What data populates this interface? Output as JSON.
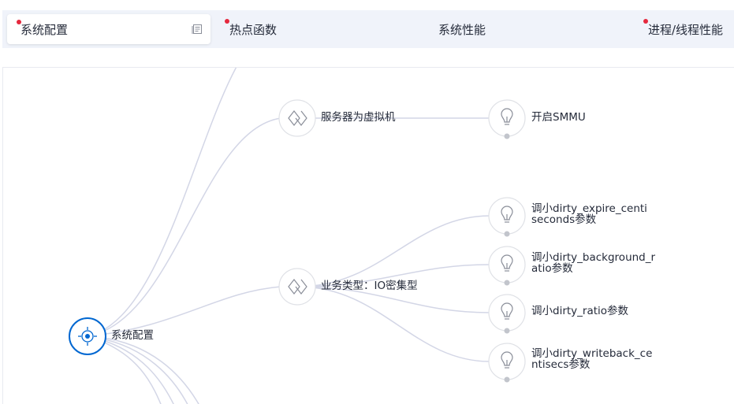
{
  "tabs": [
    {
      "label": "系统配置",
      "active": true,
      "dot": true
    },
    {
      "label": "热点函数",
      "active": false,
      "dot": true
    },
    {
      "label": "系统性能",
      "active": false,
      "dot": false
    },
    {
      "label": "进程/线程性能",
      "active": false,
      "dot": true
    }
  ],
  "graph": {
    "root": {
      "label": "系统配置",
      "icon": "target-icon"
    },
    "categories": [
      {
        "label": "服务器为虚拟机",
        "icon": "diamond-icon"
      },
      {
        "label": "业务类型：IO密集型",
        "icon": "diamond-icon"
      }
    ],
    "suggestions": [
      {
        "label_line1": "开启SMMU",
        "label_line2": "",
        "icon": "lightbulb-icon"
      },
      {
        "label_line1": "调小dirty_expire_centi",
        "label_line2": "seconds参数",
        "icon": "lightbulb-icon"
      },
      {
        "label_line1": "调小dirty_background_r",
        "label_line2": "atio参数",
        "icon": "lightbulb-icon"
      },
      {
        "label_line1": "调小dirty_ratio参数",
        "label_line2": "",
        "icon": "lightbulb-icon"
      },
      {
        "label_line1": "调小dirty_writeback_ce",
        "label_line2": "ntisecs参数",
        "icon": "lightbulb-icon"
      }
    ],
    "colors": {
      "edge": "#d3d6e6",
      "root_accent": "#0067d1",
      "node_border": "#dfe1e6",
      "icon": "#8a8e99",
      "collapse_dot": "#c2c5cc"
    }
  }
}
